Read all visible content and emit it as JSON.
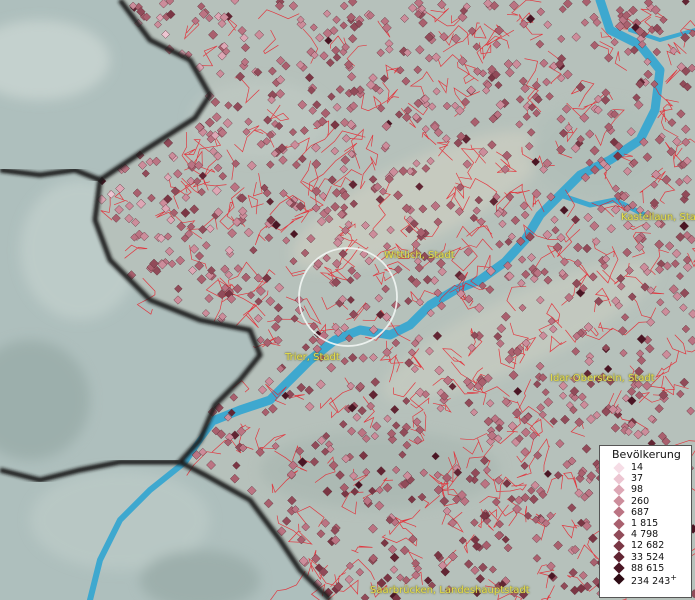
{
  "map": {
    "cities": [
      {
        "id": "wittlich",
        "name": "Wittlich, Stadt"
      },
      {
        "id": "trier",
        "name": "Trier, Stadt"
      },
      {
        "id": "kastellaun",
        "name": "Kastellaun, Stadt"
      },
      {
        "id": "idar",
        "name": "Idar-Oberstein, Stadt"
      },
      {
        "id": "saarbruecken",
        "name": "Saarbrücken, Landeshauptstadt"
      }
    ],
    "colors": {
      "terrain_out": "#aebfbd",
      "terrain_in": "#b9c1bb",
      "river": "#3ea8cf",
      "border": "#1a1a1a",
      "boundary": "#e8202a",
      "label": "#e8e04a"
    }
  },
  "legend": {
    "title": "Bevölkerung",
    "items": [
      {
        "label": "14",
        "color": "#f6dde6"
      },
      {
        "label": "37",
        "color": "#ecc5d1"
      },
      {
        "label": "98",
        "color": "#dda7b5"
      },
      {
        "label": "260",
        "color": "#cc8d9b"
      },
      {
        "label": "687",
        "color": "#bb7483"
      },
      {
        "label": "1 815",
        "color": "#a9606e"
      },
      {
        "label": "4 798",
        "color": "#914b59"
      },
      {
        "label": "12 682",
        "color": "#7a3644"
      },
      {
        "label": "33 524",
        "color": "#622533"
      },
      {
        "label": "88 615",
        "color": "#4a1624"
      },
      {
        "label": "234 243",
        "color": "#2e0b14",
        "plus": "+"
      }
    ]
  }
}
